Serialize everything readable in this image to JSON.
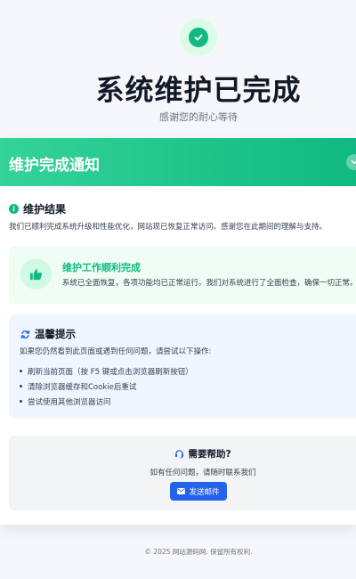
{
  "hero": {
    "title": "系统维护已完成",
    "subtitle": "感谢您的耐心等待"
  },
  "banner": {
    "title": "维护完成通知"
  },
  "result": {
    "heading": "维护结果",
    "description": "我们已顺利完成系统升级和性能优化，网站现已恢复正常访问。感谢您在此期间的理解与支持。"
  },
  "success": {
    "title": "维护工作顺利完成",
    "text": "系统已全面恢复，各项功能均已正常运行。我们对系统进行了全面检查，确保一切正常。"
  },
  "tips": {
    "heading": "温馨提示",
    "intro": "如果您仍然看到此页面或遇到任何问题，请尝试以下操作:",
    "items": [
      "刷新当前页面（按 F5 键或点击浏览器刷新按钮）",
      "清除浏览器缓存和Cookie后重试",
      "尝试使用其他浏览器访问"
    ]
  },
  "help": {
    "heading": "需要帮助?",
    "text": "如有任何问题，请随时联系我们",
    "button": "发送邮件"
  },
  "footer": {
    "text": "© 2025 网站源码网. 保留所有权利."
  },
  "colors": {
    "accent_green": "#10b981",
    "primary_blue": "#2563eb"
  },
  "icons": [
    "check-icon",
    "chevron-down-icon",
    "info-icon",
    "thumbs-up-icon",
    "refresh-icon",
    "headset-icon",
    "envelope-icon"
  ]
}
